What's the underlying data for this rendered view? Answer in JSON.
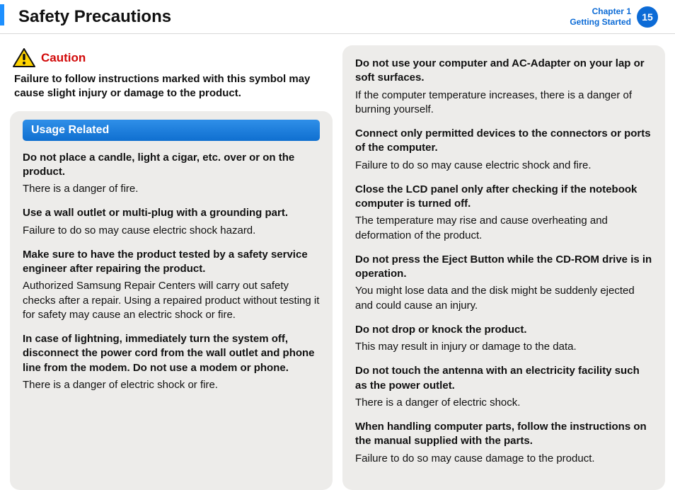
{
  "header": {
    "title": "Safety Precautions",
    "chapter_line1": "Chapter 1",
    "chapter_line2": "Getting Started",
    "page_number": "15"
  },
  "caution": {
    "label": "Caution",
    "text": "Failure to follow instructions marked with this symbol may cause slight injury or damage to the product.",
    "icon": "warning-triangle-icon"
  },
  "section": {
    "title": "Usage Related"
  },
  "items_left": [
    {
      "h": "Do not place a candle, light a cigar, etc. over or on the product.",
      "p": "There is a danger of fire."
    },
    {
      "h": "Use a wall outlet or multi-plug with a grounding part.",
      "p": "Failure to do so may cause electric shock hazard."
    },
    {
      "h": "Make sure to have the product tested by a safety service engineer after repairing the product.",
      "p": "Authorized Samsung Repair Centers will carry out safety checks after a repair. Using a repaired product without testing it for safety may cause an electric shock or fire."
    },
    {
      "h": "In case of lightning, immediately turn the system off, disconnect the power cord from the wall outlet and phone line from the modem. Do not use a modem or phone.",
      "p": "There is a danger of electric shock or fire."
    }
  ],
  "items_right": [
    {
      "h": "Do not use your computer and AC-Adapter on your lap or soft surfaces.",
      "p": "If the computer temperature increases, there is a danger of burning yourself."
    },
    {
      "h": "Connect only permitted devices to the connectors or ports of the computer.",
      "p": "Failure to do so may cause electric shock and fire."
    },
    {
      "h": "Close the LCD panel only after checking if the notebook computer is turned off.",
      "p": "The temperature may rise and cause overheating and deformation of the product."
    },
    {
      "h": "Do not press the Eject Button while the CD-ROM drive is in operation.",
      "p": "You might lose data and the disk might be suddenly ejected and could cause an injury."
    },
    {
      "h": "Do not drop or knock the product.",
      "p": "This may result in injury or damage to the data."
    },
    {
      "h": "Do not touch the antenna with an electricity facility such as the power outlet.",
      "p": "There is a danger of electric shock."
    },
    {
      "h": "When handling computer parts, follow the instructions on the manual supplied with the parts.",
      "p": "Failure to do so may cause damage to the product."
    }
  ]
}
